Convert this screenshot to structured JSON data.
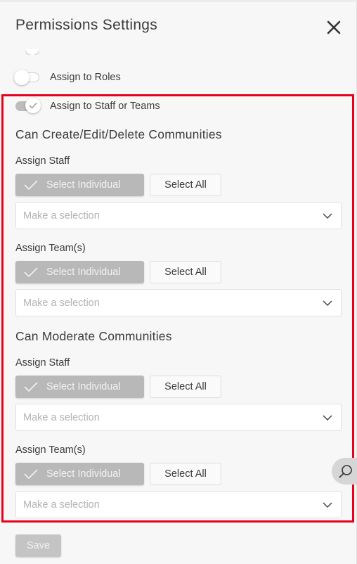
{
  "header": {
    "title": "Permissions Settings"
  },
  "toggles": {
    "assign_roles": {
      "label": "Assign to Roles",
      "state": "off"
    },
    "assign_staff_teams": {
      "label": "Assign to Staff or Teams",
      "state": "on"
    }
  },
  "sections": [
    {
      "title": "Can Create/Edit/Delete Communities",
      "groups": [
        {
          "label": "Assign Staff",
          "select_individual": "Select Individual",
          "select_all": "Select All",
          "placeholder": "Make a selection"
        },
        {
          "label": "Assign Team(s)",
          "select_individual": "Select Individual",
          "select_all": "Select All",
          "placeholder": "Make a selection"
        }
      ]
    },
    {
      "title": "Can Moderate Communities",
      "groups": [
        {
          "label": "Assign Staff",
          "select_individual": "Select Individual",
          "select_all": "Select All",
          "placeholder": "Make a selection"
        },
        {
          "label": "Assign Team(s)",
          "select_individual": "Select Individual",
          "select_all": "Select All",
          "placeholder": "Make a selection"
        }
      ]
    }
  ],
  "footer": {
    "save_label": "Save"
  },
  "icons": {
    "close": "close-icon",
    "check": "check-icon",
    "chevron": "chevron-down-icon",
    "search": "search-icon"
  },
  "colors": {
    "highlight": "#e8001c",
    "button_selected": "#b8b8b8",
    "background": "#f7f7f7"
  }
}
